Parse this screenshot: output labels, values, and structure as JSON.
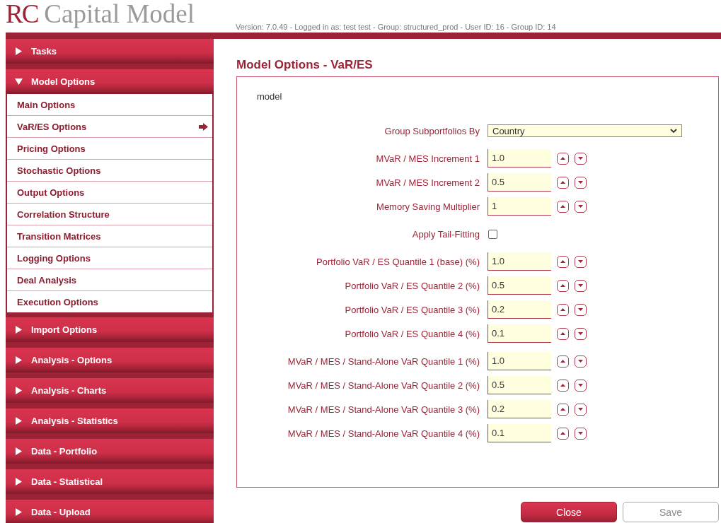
{
  "header": {
    "logo_mark": "RC",
    "logo_text": "Capital Model",
    "version_info": "Version: 7.0.49 - Logged in as: test test - Group: structured_prod - User ID: 16 - Group ID: 14"
  },
  "sidebar": {
    "sections": [
      {
        "label": "Tasks",
        "expanded": false
      },
      {
        "label": "Model Options",
        "expanded": true,
        "items": [
          {
            "label": "Main Options",
            "selected": false
          },
          {
            "label": "VaR/ES Options",
            "selected": true
          },
          {
            "label": "Pricing Options",
            "selected": false
          },
          {
            "label": "Stochastic Options",
            "selected": false
          },
          {
            "label": "Output Options",
            "selected": false
          },
          {
            "label": "Correlation Structure",
            "selected": false
          },
          {
            "label": "Transition Matrices",
            "selected": false
          },
          {
            "label": "Logging Options",
            "selected": false
          },
          {
            "label": "Deal Analysis",
            "selected": false
          },
          {
            "label": "Execution Options",
            "selected": false
          }
        ]
      },
      {
        "label": "Import Options",
        "expanded": false
      },
      {
        "label": "Analysis - Options",
        "expanded": false
      },
      {
        "label": "Analysis - Charts",
        "expanded": false
      },
      {
        "label": "Analysis - Statistics",
        "expanded": false
      },
      {
        "label": "Data - Portfolio",
        "expanded": false
      },
      {
        "label": "Data - Statistical",
        "expanded": false
      },
      {
        "label": "Data - Upload",
        "expanded": false
      }
    ]
  },
  "main": {
    "title": "Model Options - VaR/ES",
    "panel_label": "model",
    "groups": [
      [
        {
          "kind": "select",
          "label": "Group Subportfolios By",
          "value": "Country"
        }
      ],
      [
        {
          "kind": "number",
          "label": "MVaR / MES Increment 1",
          "value": "1.0"
        },
        {
          "kind": "number",
          "label": "MVaR / MES Increment 2",
          "value": "0.5"
        },
        {
          "kind": "number",
          "label": "Memory Saving Multiplier",
          "value": "1"
        }
      ],
      [
        {
          "kind": "checkbox",
          "label": "Apply Tail-Fitting",
          "checked": false
        }
      ],
      [
        {
          "kind": "number",
          "label": "Portfolio VaR / ES Quantile 1 (base) (%)",
          "value": "1.0"
        },
        {
          "kind": "number",
          "label": "Portfolio VaR / ES Quantile 2 (%)",
          "value": "0.5"
        },
        {
          "kind": "number",
          "label": "Portfolio VaR / ES Quantile 3 (%)",
          "value": "0.2"
        },
        {
          "kind": "number",
          "label": "Portfolio VaR / ES Quantile 4 (%)",
          "value": "0.1"
        }
      ],
      [
        {
          "kind": "number",
          "label": "MVaR / MES / Stand-Alone VaR Quantile 1 (%)",
          "value": "1.0"
        },
        {
          "kind": "number",
          "label": "MVaR / MES / Stand-Alone VaR Quantile 2 (%)",
          "value": "0.5"
        },
        {
          "kind": "number",
          "label": "MVaR / MES / Stand-Alone VaR Quantile 3 (%)",
          "value": "0.2"
        },
        {
          "kind": "number",
          "label": "MVaR / MES / Stand-Alone VaR Quantile 4 (%)",
          "value": "0.1"
        }
      ]
    ],
    "buttons": [
      {
        "kind": "primary",
        "label": "Close"
      },
      {
        "kind": "secondary",
        "label": "Save"
      }
    ]
  }
}
